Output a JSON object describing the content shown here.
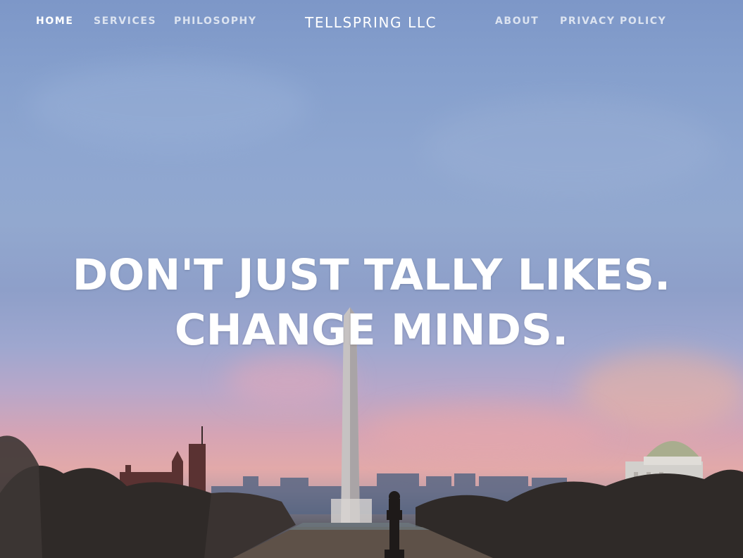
{
  "brand": "TELLSPRING LLC",
  "nav": {
    "left": [
      {
        "label": "HOME",
        "active": true
      },
      {
        "label": "SERVICES",
        "active": false
      },
      {
        "label": "PHILOSOPHY",
        "active": false
      }
    ],
    "right": [
      {
        "label": "ABOUT",
        "active": false
      },
      {
        "label": "PRIVACY POLICY",
        "active": false
      }
    ]
  },
  "hero": {
    "headline_line1": "DON'T JUST TALLY LIKES.",
    "headline_line2": "CHANGE MINDS.",
    "background_image": "washington-monument-dusk-photo"
  },
  "colors": {
    "nav_text": "#ffffff",
    "sky_top": "#7d97c8",
    "sky_pink": "#e2a9a9"
  }
}
